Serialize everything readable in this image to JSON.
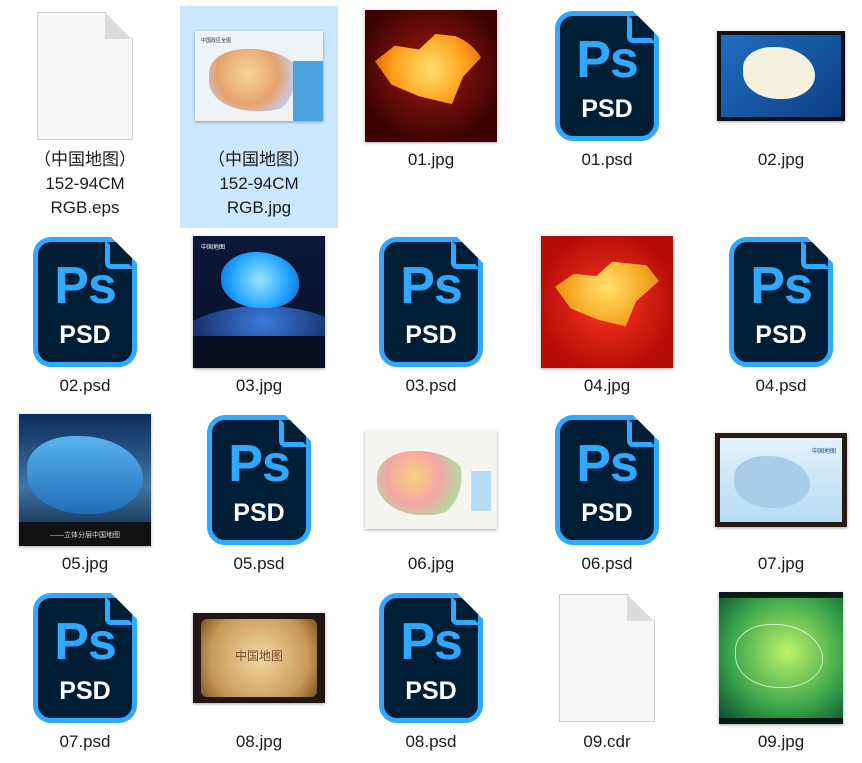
{
  "files": [
    {
      "id": "f1",
      "name": "（中国地图）\n152-94CM\nRGB.eps",
      "icon": "blank-document-icon"
    },
    {
      "id": "f2",
      "name": "（中国地图）\n152-94CM\nRGB.jpg",
      "icon": "jpg-thumbnail",
      "selected": true,
      "thumb_title": "中国政区全图"
    },
    {
      "id": "f3",
      "name": "01.jpg",
      "icon": "jpg-thumbnail"
    },
    {
      "id": "f4",
      "name": "01.psd",
      "icon": "psd-icon"
    },
    {
      "id": "f5",
      "name": "02.jpg",
      "icon": "jpg-thumbnail"
    },
    {
      "id": "f6",
      "name": "02.psd",
      "icon": "psd-icon"
    },
    {
      "id": "f7",
      "name": "03.jpg",
      "icon": "jpg-thumbnail",
      "thumb_title": "中国地图"
    },
    {
      "id": "f8",
      "name": "03.psd",
      "icon": "psd-icon"
    },
    {
      "id": "f9",
      "name": "04.jpg",
      "icon": "jpg-thumbnail"
    },
    {
      "id": "f10",
      "name": "04.psd",
      "icon": "psd-icon"
    },
    {
      "id": "f11",
      "name": "05.jpg",
      "icon": "jpg-thumbnail",
      "thumb_caption": "——立体分层中国地图"
    },
    {
      "id": "f12",
      "name": "05.psd",
      "icon": "psd-icon"
    },
    {
      "id": "f13",
      "name": "06.jpg",
      "icon": "jpg-thumbnail"
    },
    {
      "id": "f14",
      "name": "06.psd",
      "icon": "psd-icon"
    },
    {
      "id": "f15",
      "name": "07.jpg",
      "icon": "jpg-thumbnail",
      "thumb_title": "中国地图"
    },
    {
      "id": "f16",
      "name": "07.psd",
      "icon": "psd-icon"
    },
    {
      "id": "f17",
      "name": "08.jpg",
      "icon": "jpg-thumbnail",
      "thumb_title": "中国地图"
    },
    {
      "id": "f18",
      "name": "08.psd",
      "icon": "psd-icon"
    },
    {
      "id": "f19",
      "name": "09.cdr",
      "icon": "blank-document-icon"
    },
    {
      "id": "f20",
      "name": "09.jpg",
      "icon": "jpg-thumbnail"
    }
  ],
  "psd_icon": {
    "top": "Ps",
    "bottom": "PSD",
    "accent": "#31a8ff",
    "background": "#001e36"
  },
  "selection_color": "#cce8ff"
}
